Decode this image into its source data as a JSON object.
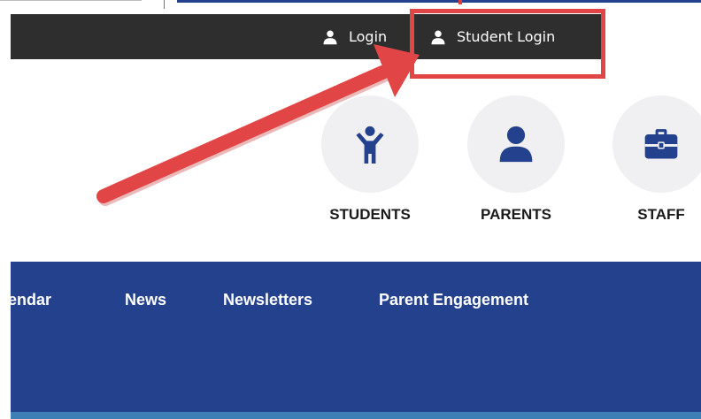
{
  "utility": {
    "login_label": "Login",
    "student_login_label": "Student Login",
    "login_icon": "user-icon",
    "student_login_icon": "user-icon"
  },
  "audience": {
    "students_label": "STUDENTS",
    "parents_label": "PARENTS",
    "staff_label": "STAFF",
    "students_icon": "child-icon",
    "parents_icon": "user-icon",
    "staff_icon": "briefcase-icon"
  },
  "nav": {
    "items": [
      "alendar",
      "News",
      "Newsletters",
      "Parent Engagement"
    ]
  },
  "colors": {
    "utility_bar": "#2e2e2e",
    "nav_bar": "#24418e",
    "icon": "#24418e",
    "annotation": "#e24545",
    "circle": "#f0f0f2"
  }
}
